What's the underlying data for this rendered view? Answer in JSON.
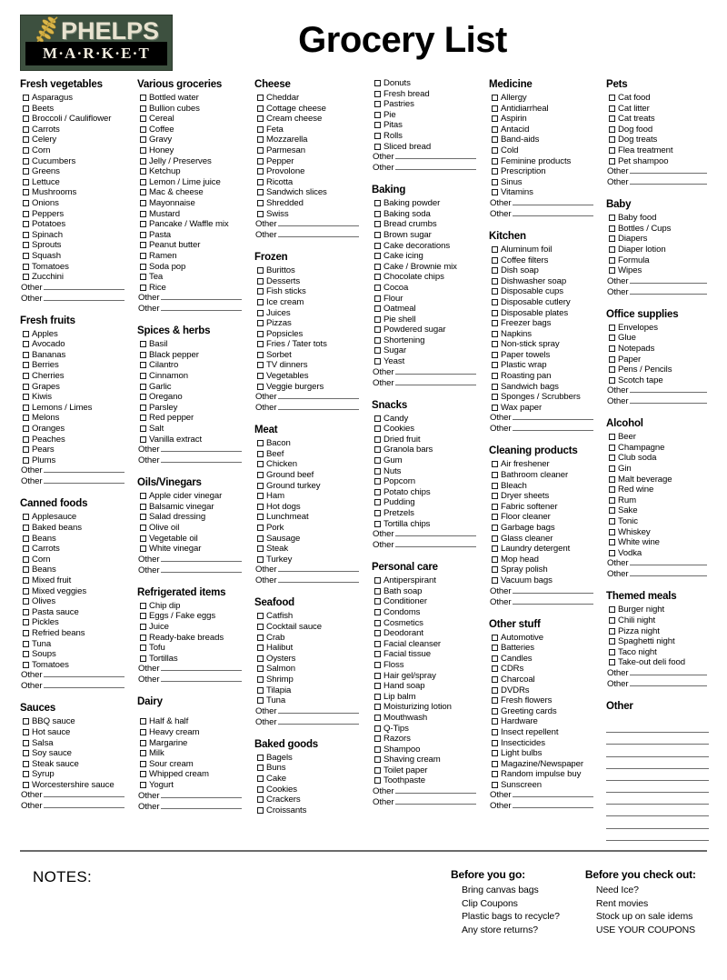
{
  "header": {
    "title": "Grocery List",
    "logo": {
      "brand": "PHELPS",
      "sub": "M·A·R·K·E·T"
    }
  },
  "columns": [
    {
      "sections": [
        {
          "heading": "Fresh vegetables",
          "items": [
            "Asparagus",
            "Beets",
            "Broccoli / Cauliflower",
            "Carrots",
            "Celery",
            "Corn",
            "Cucumbers",
            "Greens",
            "Lettuce",
            "Mushrooms",
            "Onions",
            "Peppers",
            "Potatoes",
            "Spinach",
            "Sprouts",
            "Squash",
            "Tomatoes",
            "Zucchini"
          ],
          "others": [
            "Other",
            "Other"
          ]
        },
        {
          "heading": "Fresh fruits",
          "items": [
            "Apples",
            "Avocado",
            "Bananas",
            "Berries",
            "Cherries",
            "Grapes",
            "Kiwis",
            "Lemons / Limes",
            "Melons",
            "Oranges",
            "Peaches",
            "Pears",
            "Plums"
          ],
          "others": [
            "Other",
            "Other"
          ]
        },
        {
          "heading": "Canned foods",
          "items": [
            "Applesauce",
            "Baked beans",
            "Beans",
            "Carrots",
            "Corn",
            "Beans",
            "Mixed fruit",
            "Mixed veggies",
            "Olives",
            "Pasta sauce",
            "Pickles",
            "Refried beans",
            "Tuna",
            "Soups",
            "Tomatoes"
          ],
          "others": [
            "Other",
            "Other"
          ]
        },
        {
          "heading": "Sauces",
          "items": [
            "BBQ sauce",
            "Hot sauce",
            "Salsa",
            "Soy sauce",
            "Steak sauce",
            "Syrup",
            "Worcestershire sauce"
          ],
          "others": [
            "Other",
            "Other"
          ]
        }
      ]
    },
    {
      "sections": [
        {
          "heading": "Various groceries",
          "items": [
            "Bottled water",
            "Bullion cubes",
            "Cereal",
            "Coffee",
            "Gravy",
            "Honey",
            "Jelly / Preserves",
            "Ketchup",
            "Lemon / Lime juice",
            "Mac & cheese",
            "Mayonnaise",
            "Mustard",
            "Pancake / Waffle mix",
            "Pasta",
            "Peanut butter",
            "Ramen",
            "Soda pop",
            "Tea",
            "Rice"
          ],
          "others": [
            "Other",
            "Other"
          ]
        },
        {
          "heading": "Spices & herbs",
          "items": [
            "Basil",
            "Black pepper",
            "Cilantro",
            "Cinnamon",
            "Garlic",
            "Oregano",
            "Parsley",
            "Red pepper",
            "Salt",
            "Vanilla extract"
          ],
          "others": [
            "Other",
            "Other"
          ]
        },
        {
          "heading": "Oils/Vinegars",
          "items": [
            "Apple cider vinegar",
            "Balsamic vinegar",
            "Salad dressing",
            "Olive oil",
            "Vegetable oil",
            "White vinegar"
          ],
          "others": [
            "Other",
            "Other"
          ]
        },
        {
          "heading": "Refrigerated items",
          "items": [
            "Chip dip",
            "Eggs / Fake eggs",
            "Juice",
            "Ready-bake breads",
            "Tofu",
            "Tortillas"
          ],
          "others": [
            "Other",
            "Other"
          ]
        },
        {
          "heading": "Dairy",
          "heading_gap": true,
          "items": [
            "Half & half",
            "Heavy cream",
            "Margarine",
            "Milk",
            "Sour cream",
            "Whipped cream",
            "Yogurt"
          ],
          "others": [
            "Other",
            "Other"
          ]
        }
      ]
    },
    {
      "sections": [
        {
          "heading": "Cheese",
          "items": [
            "Cheddar",
            "Cottage cheese",
            "Cream cheese",
            "Feta",
            "Mozzarella",
            "Parmesan",
            "Pepper",
            "Provolone",
            "Ricotta",
            "Sandwich slices",
            "Shredded",
            "Swiss"
          ],
          "others": [
            "Other",
            "Other"
          ]
        },
        {
          "heading": "Frozen",
          "items": [
            "Burittos",
            "Desserts",
            "Fish sticks",
            "Ice cream",
            "Juices",
            "Pizzas",
            "Popsicles",
            "Fries / Tater tots",
            "Sorbet",
            "TV dinners",
            "Vegetables",
            "Veggie burgers"
          ],
          "others": [
            "Other",
            "Other"
          ]
        },
        {
          "heading": "Meat",
          "items": [
            "Bacon",
            "Beef",
            "Chicken",
            "Ground beef",
            "Ground turkey",
            "Ham",
            "Hot dogs",
            "Lunchmeat",
            "Pork",
            "Sausage",
            "Steak",
            "Turkey"
          ],
          "others": [
            "Other",
            "Other"
          ]
        },
        {
          "heading": "Seafood",
          "items": [
            "Catfish",
            "Cocktail sauce",
            "Crab",
            "Halibut",
            "Oysters",
            "Salmon",
            "Shrimp",
            "Tilapia",
            "Tuna"
          ],
          "others": [
            "Other",
            "Other"
          ]
        },
        {
          "heading": "Baked goods",
          "items": [
            "Bagels",
            "Buns",
            "Cake",
            "Cookies",
            "Crackers",
            "Croissants"
          ],
          "others": []
        }
      ]
    },
    {
      "sections": [
        {
          "heading": "",
          "items": [
            "Donuts",
            "Fresh bread",
            "Pastries",
            "Pie",
            "Pitas",
            "Rolls",
            "Sliced bread"
          ],
          "others": [
            "Other",
            "Other"
          ]
        },
        {
          "heading": "Baking",
          "items": [
            "Baking powder",
            "Baking soda",
            "Bread crumbs",
            "Brown sugar",
            "Cake decorations",
            "Cake icing",
            "Cake / Brownie mix",
            "Chocolate chips",
            "Cocoa",
            "Flour",
            "Oatmeal",
            "Pie shell",
            "Powdered sugar",
            "Shortening",
            "Sugar",
            "Yeast"
          ],
          "others": [
            "Other",
            "Other"
          ]
        },
        {
          "heading": "Snacks",
          "items": [
            "Candy",
            "Cookies",
            "Dried fruit",
            "Granola bars",
            "Gum",
            "Nuts",
            "Popcorn",
            "Potato chips",
            "Pudding",
            "Pretzels",
            "Tortilla chips"
          ],
          "others": [
            "Other",
            "Other"
          ]
        },
        {
          "heading": "Personal care",
          "items": [
            "Antiperspirant",
            "Bath soap",
            "Conditioner",
            "Condoms",
            "Cosmetics",
            "Deodorant",
            "Facial cleanser",
            "Facial tissue",
            "Floss",
            "Hair gel/spray",
            "Hand soap",
            "Lip balm",
            "Moisturizing lotion",
            "Mouthwash",
            "Q-Tips",
            "Razors",
            "Shampoo",
            "Shaving cream",
            "Toilet paper",
            "Toothpaste"
          ],
          "others": [
            "Other",
            "Other"
          ]
        }
      ]
    },
    {
      "sections": [
        {
          "heading": "Medicine",
          "items": [
            "Allergy",
            "Antidiarrheal",
            "Aspirin",
            "Antacid",
            "Band-aids",
            "Cold",
            "Feminine products",
            "Prescription",
            "Sinus",
            "Vitamins"
          ],
          "others": [
            "Other",
            "Other"
          ]
        },
        {
          "heading": "Kitchen",
          "items": [
            "Aluminum foil",
            "Coffee filters",
            "Dish soap",
            "Dishwasher soap",
            "Disposable cups",
            "Disposable cutlery",
            "Disposable plates",
            "Freezer bags",
            "Napkins",
            "Non-stick spray",
            "Paper towels",
            "Plastic wrap",
            "Roasting pan",
            "Sandwich bags",
            "Sponges / Scrubbers",
            "Wax paper"
          ],
          "others": [
            "Other",
            "Other"
          ]
        },
        {
          "heading": "Cleaning products",
          "items": [
            "Air freshener",
            "Bathroom cleaner",
            "Bleach",
            "Dryer sheets",
            "Fabric softener",
            "Floor cleaner",
            "Garbage bags",
            "Glass cleaner",
            "Laundry detergent",
            "Mop head",
            "Spray polish",
            "Vacuum bags"
          ],
          "others": [
            "Other",
            "Other"
          ]
        },
        {
          "heading": "Other stuff",
          "items": [
            "Automotive",
            "Batteries",
            "Candles",
            "CDRs",
            "Charcoal",
            "DVDRs",
            "Fresh flowers",
            "Greeting cards",
            "Hardware",
            "Insect repellent",
            "Insecticides",
            "Light bulbs",
            "Magazine/Newspaper",
            "Random impulse buy",
            "Sunscreen"
          ],
          "others": [
            "Other",
            "Other"
          ]
        }
      ]
    },
    {
      "sections": [
        {
          "heading": "Pets",
          "items": [
            "Cat food",
            "Cat litter",
            "Cat treats",
            "Dog food",
            "Dog treats",
            "Flea treatment",
            "Pet shampoo"
          ],
          "others": [
            "Other",
            "Other"
          ]
        },
        {
          "heading": "Baby",
          "items": [
            "Baby food",
            "Bottles / Cups",
            "Diapers",
            "Diaper lotion",
            "Formula",
            "Wipes"
          ],
          "others": [
            "Other",
            "Other"
          ]
        },
        {
          "heading": "Office supplies",
          "items": [
            "Envelopes",
            "Glue",
            "Notepads",
            "Paper",
            "Pens / Pencils",
            "Scotch tape"
          ],
          "others": [
            "Other",
            "Other"
          ]
        },
        {
          "heading": "Alcohol",
          "items": [
            "Beer",
            "Champagne",
            "Club soda",
            "Gin",
            "Malt beverage",
            "Red wine",
            "Rum",
            "Sake",
            "Tonic",
            "Whiskey",
            "White wine",
            "Vodka"
          ],
          "others": [
            "Other",
            "Other"
          ]
        },
        {
          "heading": "Themed meals",
          "items": [
            "Burger night",
            "Chili night",
            "Pizza night",
            "Spaghetti night",
            "Taco night",
            "Take-out deli food"
          ],
          "others": [
            "Other",
            "Other"
          ]
        },
        {
          "heading": "Other",
          "heading_gap": true,
          "items": [],
          "blank_lines": 10
        }
      ]
    }
  ],
  "footer": {
    "notes_label": "NOTES:",
    "before_you_go": {
      "heading": "Before you go:",
      "items": [
        "Bring canvas bags",
        "Clip Coupons",
        "Plastic bags to recycle?",
        "Any store returns?"
      ]
    },
    "before_you_check_out": {
      "heading": "Before you check out:",
      "items": [
        "Need Ice?",
        "Rent movies",
        "Stock up on sale idems",
        "USE YOUR COUPONS"
      ]
    }
  }
}
